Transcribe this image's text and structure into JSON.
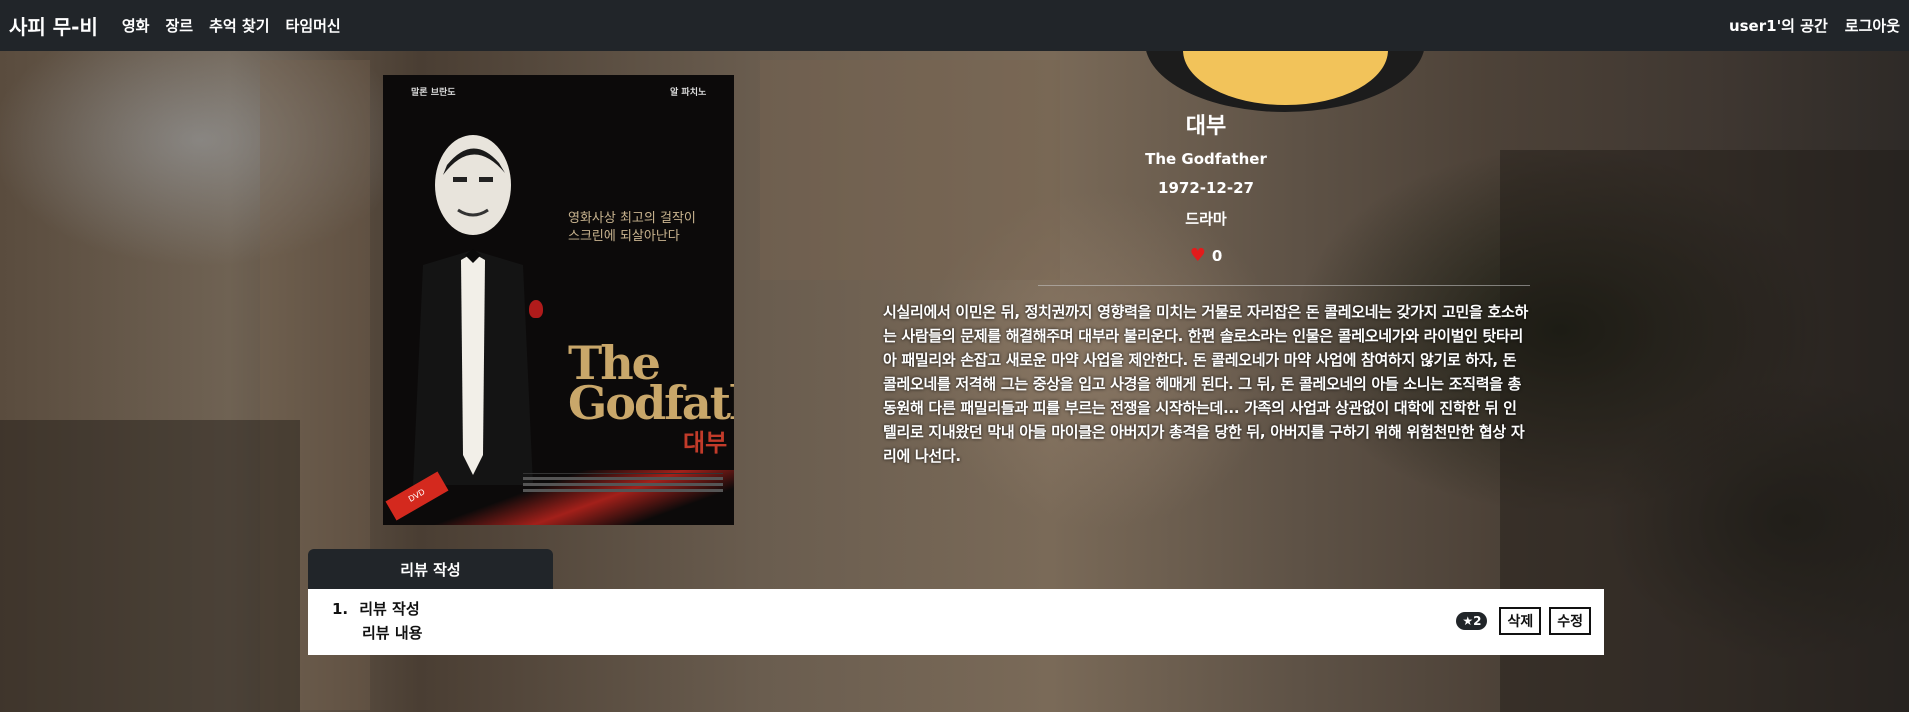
{
  "nav": {
    "brand": "사피 무-비",
    "links": [
      "영화",
      "장르",
      "추억 찾기",
      "타임머신"
    ],
    "user_space": "user1'의 공간",
    "logout": "로그아웃"
  },
  "poster": {
    "top_left": "말론 브란도",
    "top_right": "알 파치노",
    "tagline": "영화사상 최고의 걸작이\n스크린에 되살아난다",
    "title": "The Godfather",
    "title_kr": "대부"
  },
  "movie": {
    "title_kr": "대부",
    "title_en": "The Godfather",
    "release_date": "1972-12-27",
    "genre": "드라마",
    "likes": "0",
    "overview": "시실리에서 이민온 뒤, 정치권까지 영향력을 미치는 거물로 자리잡은 돈 콜레오네는 갖가지 고민을 호소하는 사람들의 문제를 해결해주며 대부라 불리운다. 한편 솔로소라는 인물은 콜레오네가와 라이벌인 탓타리아 패밀리와 손잡고 새로운 마약 사업을 제안한다. 돈 콜레오네가 마약 사업에 참여하지 않기로 하자, 돈 콜레오네를 저격해 그는 중상을 입고 사경을 헤매게 된다. 그 뒤, 돈 콜레오네의 아들 소니는 조직력을 총 동원해 다른 패밀리들과 피를 부르는 전쟁을 시작하는데... 가족의 사업과 상관없이 대학에 진학한 뒤 인텔리로 지내왔던 막내 아들 마이클은 아버지가 총격을 당한 뒤, 아버지를 구하기 위해 위험천만한 협상 자리에 나선다."
  },
  "review": {
    "tab_label": "리뷰 작성",
    "items": [
      {
        "number": "1.",
        "title": "리뷰 작성",
        "content": "리뷰 내용",
        "rating": "★2",
        "delete_label": "삭제",
        "edit_label": "수정"
      }
    ]
  },
  "colors": {
    "navbar": "#212529",
    "heart": "#e31b1b",
    "review_box": "#ffffff"
  }
}
